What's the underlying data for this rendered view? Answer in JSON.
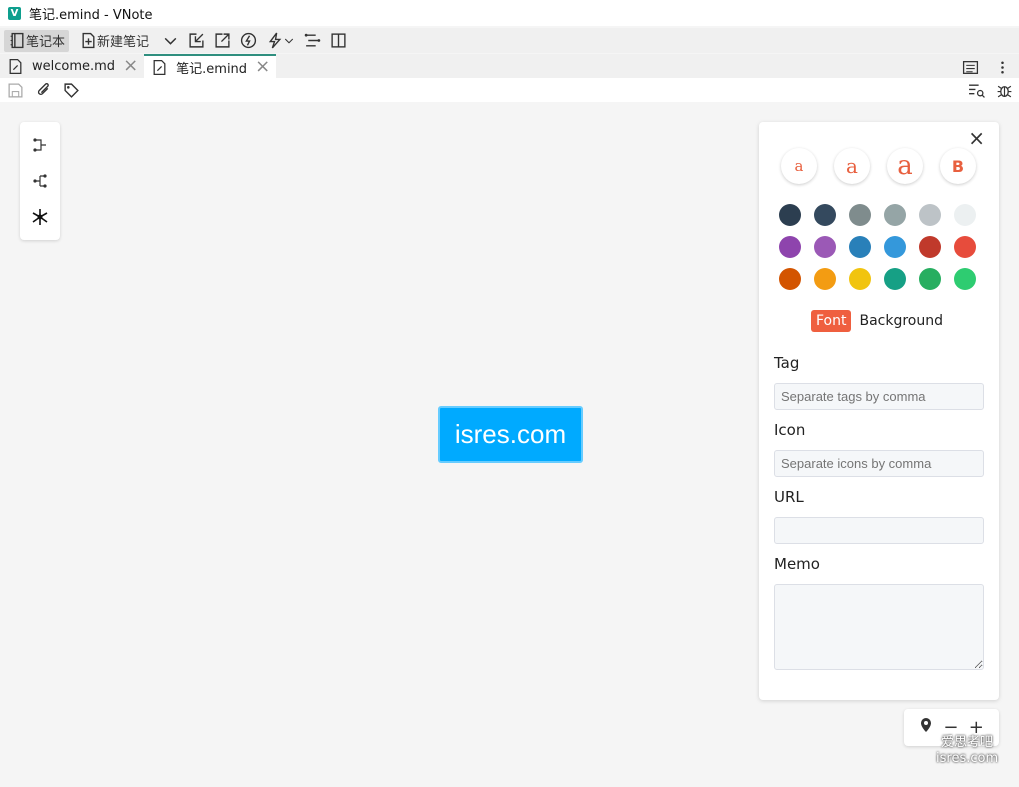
{
  "window": {
    "title": "笔记.emind - VNote",
    "app_icon_letter": "V"
  },
  "toolbar": {
    "notebook_label": "笔记本",
    "new_note_label": "新建笔记"
  },
  "tabs": [
    {
      "label": "welcome.md",
      "active": false
    },
    {
      "label": "笔记.emind",
      "active": true
    }
  ],
  "mindmap": {
    "root_node_text": "isres.com",
    "node_color": "#00aaff"
  },
  "style_panel": {
    "font_sizes": [
      "a",
      "a",
      "a",
      "B"
    ],
    "swatches": [
      "#2c3e50",
      "#34495e",
      "#7f8c8d",
      "#95a5a6",
      "#bdc3c7",
      "#ecf0f1",
      "#8e44ad",
      "#9b59b6",
      "#2980b9",
      "#3498db",
      "#c0392b",
      "#e74c3c",
      "#d35400",
      "#f39c12",
      "#f1c40f",
      "#16a085",
      "#27ae60",
      "#2ecc71"
    ],
    "font_toggle": "Font",
    "background_toggle": "Background",
    "tag_label": "Tag",
    "tag_placeholder": "Separate tags by comma",
    "icon_label": "Icon",
    "icon_placeholder": "Separate icons by comma",
    "url_label": "URL",
    "url_value": "",
    "memo_label": "Memo"
  },
  "zoom": {
    "minus": "−",
    "plus": "+"
  },
  "watermark": {
    "line1": "爱思考吧",
    "line2": "isres.com"
  }
}
